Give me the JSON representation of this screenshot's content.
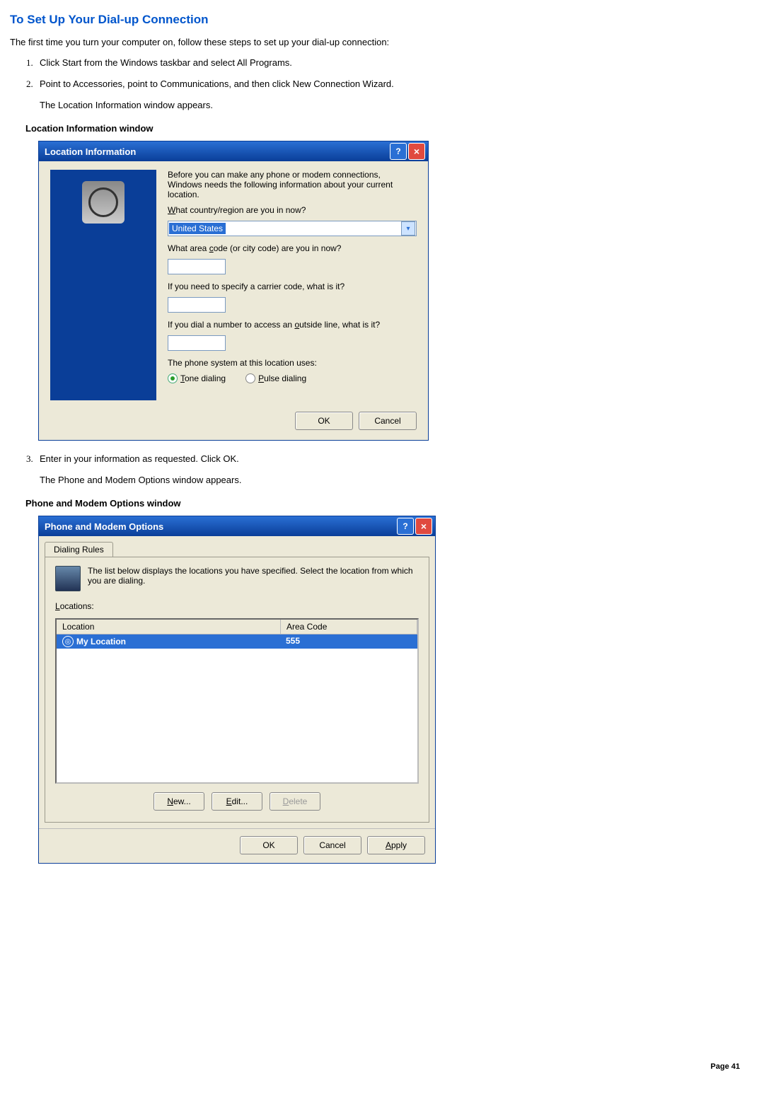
{
  "title": "To Set Up Your Dial-up Connection",
  "intro": "The first time you turn your computer on, follow these steps to set up your dial-up connection:",
  "steps": {
    "s1": "Click Start from the Windows taskbar and select All Programs.",
    "s2": "Point to Accessories, point to Communications, and then click New Connection Wizard.",
    "s2b": "The Location Information window appears.",
    "s3": "Enter in your information as requested. Click OK.",
    "s3b": "The Phone and Modem Options window appears."
  },
  "fig1_caption": "Location Information window",
  "fig2_caption": "Phone and Modem Options window",
  "win1": {
    "title": "Location Information",
    "desc": "Before you can make any phone or modem connections, Windows needs the following information about your current location.",
    "q_country_pre": "W",
    "q_country_post": "hat country/region are you in now?",
    "country_value": "United States",
    "q_area_pre": "What area ",
    "q_area_u": "c",
    "q_area_post": "ode (or city code) are you in now?",
    "q_carrier": "If you need to specify a carrier code, what is it?",
    "q_outside_pre": "If you dial a number to access an ",
    "q_outside_u": "o",
    "q_outside_post": "utside line, what is it?",
    "q_phone": "The phone system at this location uses:",
    "radio_tone_u": "T",
    "radio_tone_post": "one dialing",
    "radio_pulse_u": "P",
    "radio_pulse_post": "ulse dialing",
    "ok": "OK",
    "cancel": "Cancel"
  },
  "win2": {
    "title": "Phone and Modem Options",
    "tab": "Dialing Rules",
    "desc": "The list below displays the locations you have specified. Select the location from which you are dialing.",
    "locations_u": "L",
    "locations_post": "ocations:",
    "col_location": "Location",
    "col_area": "Area Code",
    "row_loc": "My Location",
    "row_area": "555",
    "new_u": "N",
    "new_post": "ew...",
    "edit_u": "E",
    "edit_post": "dit...",
    "delete_u": "D",
    "delete_post": "elete",
    "ok": "OK",
    "cancel": "Cancel",
    "apply_u": "A",
    "apply_post": "pply"
  },
  "page_num": "Page 41"
}
